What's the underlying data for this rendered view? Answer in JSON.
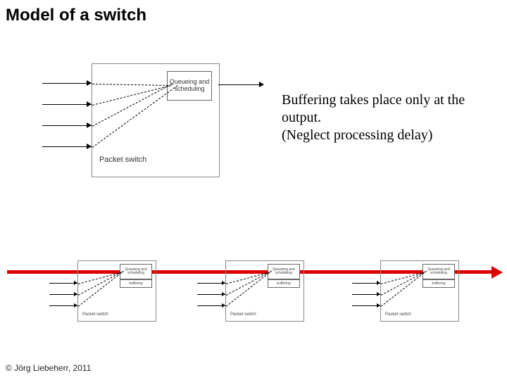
{
  "title": "Model of a switch",
  "body_text": "Buffering takes place only at the output.\n(Neglect processing delay)",
  "footer": "© Jörg Liebeherr, 2011",
  "diagram": {
    "qs_label": "Queueing and scheduling",
    "ps_label": "Packet switch",
    "buffering_label": "buffering"
  }
}
